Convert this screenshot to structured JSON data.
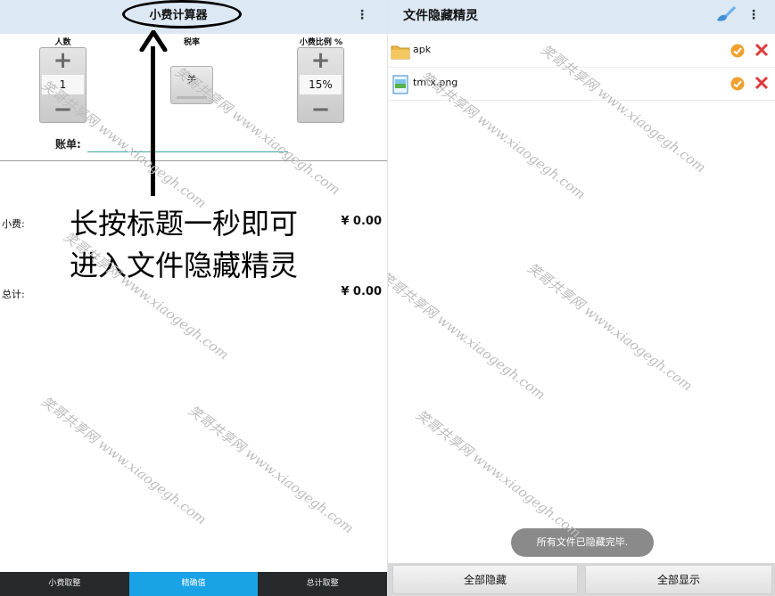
{
  "left_app": {
    "title": "小费计算器",
    "menu_icon": "overflow-menu-icon",
    "steppers": {
      "people": {
        "label": "人数",
        "value": "1",
        "plus": "+",
        "minus": "−"
      },
      "tax": {
        "label": "税率",
        "toggle": "关"
      },
      "tip_pct": {
        "label": "小费比例 %",
        "value": "15%",
        "plus": "+",
        "minus": "−"
      }
    },
    "bill_label": "账单:",
    "tip_label": "小费:",
    "tip_value": "¥ 0.00",
    "total_label": "总计:",
    "total_value": "¥ 0.00",
    "annotation_line1": "长按标题一秒即可",
    "annotation_line2": "进入文件隐藏精灵",
    "bottom_tabs": [
      {
        "label": "小费取整",
        "active": false
      },
      {
        "label": "精确值",
        "active": true
      },
      {
        "label": "总计取整",
        "active": false
      }
    ]
  },
  "right_app": {
    "title": "文件隐藏精灵",
    "brush_icon": "brush-icon",
    "menu_icon": "overflow-menu-icon",
    "files": [
      {
        "name": "apk",
        "icon": "folder-icon"
      },
      {
        "name": "tmtx.png",
        "icon": "image-file-icon"
      }
    ],
    "toast": "所有文件已隐藏完毕.",
    "hide_all": "全部隐藏",
    "show_all": "全部显示"
  },
  "watermark": "笑哥共享网 www.xiaogegh.com",
  "colors": {
    "title_bar": "#dde8f5",
    "accent_tab": "#1aa2e6",
    "bottom_bar": "#262a2d",
    "ok_orange": "#f0a030",
    "delete_red": "#e03a3a"
  }
}
